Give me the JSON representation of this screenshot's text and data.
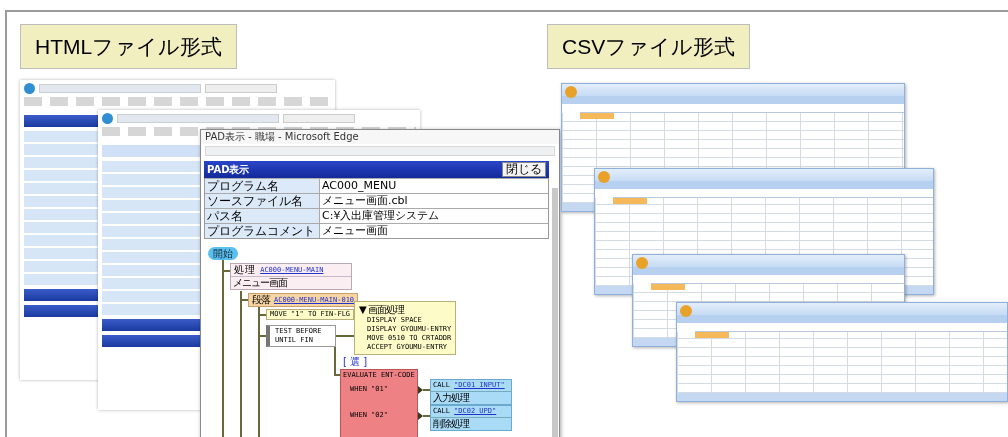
{
  "panels": [
    {
      "heading": "HTMLファイル形式"
    },
    {
      "heading": "CSVファイル形式"
    }
  ],
  "pad_window": {
    "title": "PAD表示 - 職場 - Microsoft Edge",
    "header": "PAD表示",
    "close_button": "閉じる",
    "info_rows": [
      [
        {
          "label": "プログラム名",
          "value": "AC000_MENU"
        }
      ],
      [
        {
          "label": "ソースファイル名",
          "value": "メニュー画面.cbl"
        }
      ],
      [
        {
          "label": "パス名",
          "value": "C:¥入出庫管理システム"
        }
      ],
      [
        {
          "label": "プログラムコメント",
          "value": "メニュー画面"
        }
      ]
    ],
    "diagram": {
      "start": "開始",
      "process": {
        "label": "処 理",
        "link": "AC000-MENU-MAIN",
        "comment": "メニュー画面"
      },
      "paragraph": {
        "label": "段落",
        "link": "AC000-MENU-MAIN-010"
      },
      "move": "MOVE \"1\" TO FIN-FLG",
      "loop": [
        "TEST BEFORE",
        "UNTIL FIN"
      ],
      "block": {
        "title": "▼ 画面処理",
        "lines": [
          "DISPLAY SPACE",
          "DISPLAY GYOUMU-ENTRY",
          "MOVE 0510 TO CRTADDR",
          "ACCEPT GYOUMU-ENTRY"
        ]
      },
      "select_label": "[ 選 ]",
      "evaluate": "EVALUATE ENT-CODE",
      "cases": [
        {
          "when": "WHEN \"01\"",
          "call": "CALL",
          "target": "\"DC01_INPUT\"",
          "comment": "入力処理"
        },
        {
          "when": "WHEN \"02\"",
          "call": "CALL",
          "target": "\"DC02_UPD\"",
          "comment": "削除処理"
        }
      ]
    }
  }
}
